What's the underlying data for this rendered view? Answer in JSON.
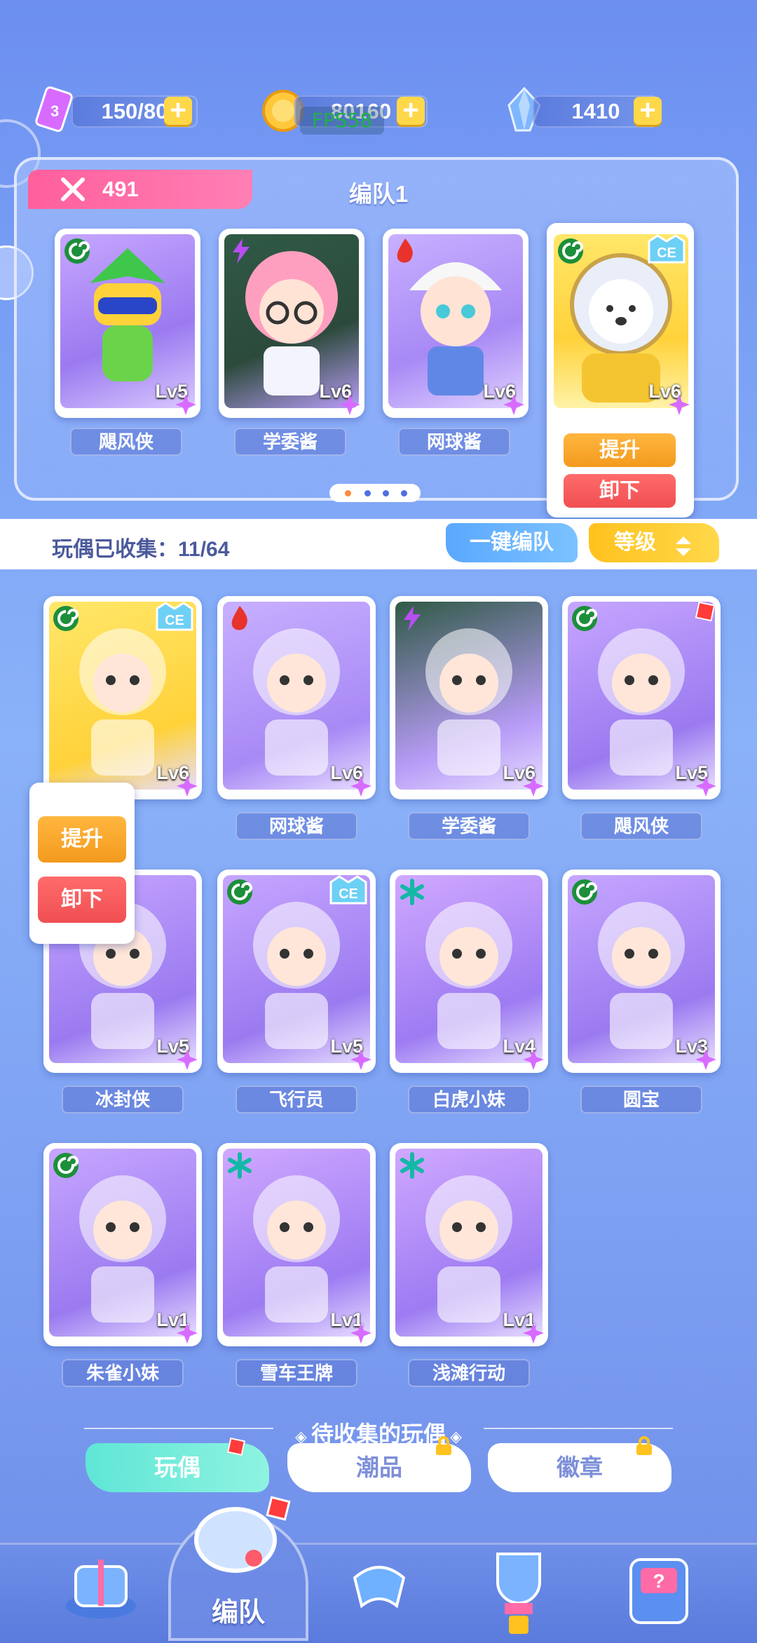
{
  "resources": {
    "energy": "150/80",
    "coins": "80160",
    "gems": "1410",
    "fps": "FPS58"
  },
  "team": {
    "power": "491",
    "title": "编队1",
    "members": [
      {
        "name": "飓风侠",
        "level": "Lv5",
        "element": "wind"
      },
      {
        "name": "学委酱",
        "level": "Lv6",
        "element": "lightning"
      },
      {
        "name": "网球酱",
        "level": "Lv6",
        "element": "fire"
      },
      {
        "name": "",
        "level": "Lv6",
        "element": "wind",
        "badge": "CE"
      }
    ],
    "popup": {
      "upgrade": "提升",
      "remove": "卸下"
    },
    "page_count": 4,
    "active_page": 1
  },
  "collection": {
    "label": "玩偶已收集：",
    "count": "11/64",
    "quick_team": "一键编队",
    "sort": "等级",
    "popup": {
      "upgrade": "提升",
      "remove": "卸下"
    },
    "dolls": [
      {
        "name": "",
        "level": "Lv6",
        "element": "wind",
        "badge": "CE"
      },
      {
        "name": "网球酱",
        "level": "Lv6",
        "element": "fire"
      },
      {
        "name": "学委酱",
        "level": "Lv6",
        "element": "lightning"
      },
      {
        "name": "飓风侠",
        "level": "Lv5",
        "element": "wind"
      },
      {
        "name": "冰封侠",
        "level": "Lv5",
        "element": "wind"
      },
      {
        "name": "飞行员",
        "level": "Lv5",
        "element": "wind",
        "badge": "CE"
      },
      {
        "name": "白虎小妹",
        "level": "Lv4",
        "element": "ice"
      },
      {
        "name": "圆宝",
        "level": "Lv3",
        "element": "wind"
      },
      {
        "name": "朱雀小妹",
        "level": "Lv1",
        "element": "wind"
      },
      {
        "name": "雪车王牌",
        "level": "Lv1",
        "element": "ice"
      },
      {
        "name": "浅滩行动",
        "level": "Lv1",
        "element": "ice"
      }
    ]
  },
  "pending": {
    "title": "待收集的玩偶",
    "tabs": [
      {
        "label": "玩偶",
        "active": true,
        "locked": false
      },
      {
        "label": "潮品",
        "active": false,
        "locked": true
      },
      {
        "label": "徽章",
        "active": false,
        "locked": true
      }
    ]
  },
  "nav": {
    "active_label": "编队"
  },
  "colors": {
    "power_pink": "#ff5f9c",
    "upgrade_orange": "#f39a1e",
    "remove_red": "#f04f52",
    "quick_blue": "#5aa8ff",
    "sort_yellow": "#ffc21e",
    "tab_teal": "#5fe6d6"
  }
}
